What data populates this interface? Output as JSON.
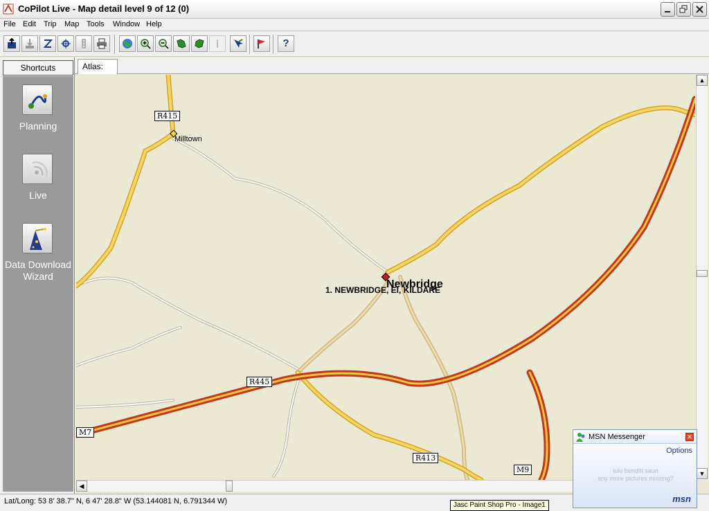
{
  "window": {
    "title": "CoPilot Live - Map detail level 9 of 12 (0)"
  },
  "menu": [
    "File",
    "Edit",
    "Trip",
    "Map",
    "Tools",
    "Window",
    "Help"
  ],
  "toolbar": {
    "buttons": [
      "save-icon",
      "download-icon",
      "route-icon",
      "gps-icon",
      "traffic-icon",
      "print-icon",
      "globe-icon",
      "zoom-in-icon",
      "zoom-out-icon",
      "map-left-icon",
      "map-right-icon",
      "divider-icon",
      "pointer-icon",
      "flag-icon",
      "help-icon"
    ],
    "help_label": "?"
  },
  "shortcuts": {
    "header": "Shortcuts",
    "items": [
      {
        "label": "Planning",
        "icon": "planning-icon"
      },
      {
        "label": "Live",
        "icon": "live-icon"
      },
      {
        "label": "Data Download Wizard",
        "icon": "wizard-icon"
      }
    ]
  },
  "atlas": {
    "tab_label": "Atlas:"
  },
  "map": {
    "place_milltown": "Milltown",
    "place_newbridge": "Newbridge",
    "stop_label": "1. NEWBRIDGE, EI, KILDARE",
    "shields": [
      "R415",
      "R445",
      "M7",
      "R413",
      "M9"
    ],
    "colors": {
      "background": "#ebe8d4",
      "motorway": "#cc3300",
      "motorway_core": "#f5c242",
      "regional": "#f5c242",
      "minor": "#ffffff"
    }
  },
  "status": {
    "latlong": "Lat/Long:  53  8' 38.7\" N,   6 47' 28.8\" W (53.144081 N, 6.791344 W)"
  },
  "tooltip": {
    "text": "Jasc Paint Shop Pro - Image1"
  },
  "msn": {
    "title": "MSN Messenger",
    "options": "Options",
    "message": "lulu bendfit saun\nany more pictures missing?",
    "logo": "msn"
  }
}
